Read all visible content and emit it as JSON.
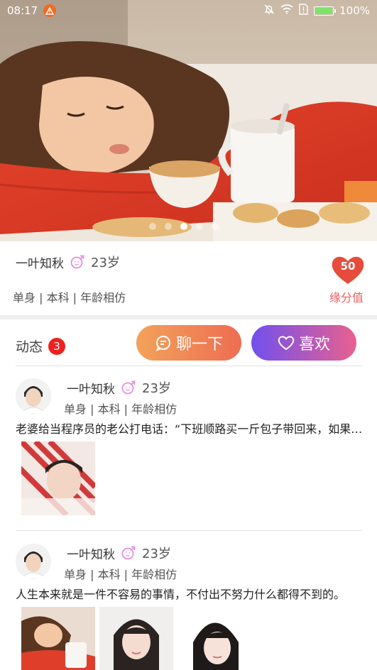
{
  "status_bar": {
    "time": "08:17",
    "battery": "100%"
  },
  "banner": {
    "slides": 5,
    "active_index": 2
  },
  "profile": {
    "name": "一叶知秋",
    "age": "23岁",
    "tags": "单身 | 本科 | 年龄相仿",
    "fate_score": "50",
    "fate_label": "缘分值"
  },
  "actions": {
    "feed_label": "动态",
    "feed_count": "3",
    "chat_label": "聊一下",
    "like_label": "喜欢"
  },
  "posts": [
    {
      "name": "一叶知秋",
      "age": "23岁",
      "tags": "单身 | 本科 | 年龄相仿",
      "text": "老婆给当程序员的老公打电话：“下班顺路买一斤包子带回来，如果看到卖西瓜的，买一个。”",
      "images": 1
    },
    {
      "name": "一叶知秋",
      "age": "23岁",
      "tags": "单身 | 本科 | 年龄相仿",
      "text": "人生本来就是一件不容易的事情，不付出不努力什么都得不到的。",
      "images": 3
    }
  ],
  "colors": {
    "fate_red": "#ec5f5f",
    "chat_gradient": [
      "#f2a25a",
      "#ee6d52"
    ],
    "like_gradient": [
      "#7150ee",
      "#e9608f"
    ],
    "badge_red": "#f02020"
  }
}
